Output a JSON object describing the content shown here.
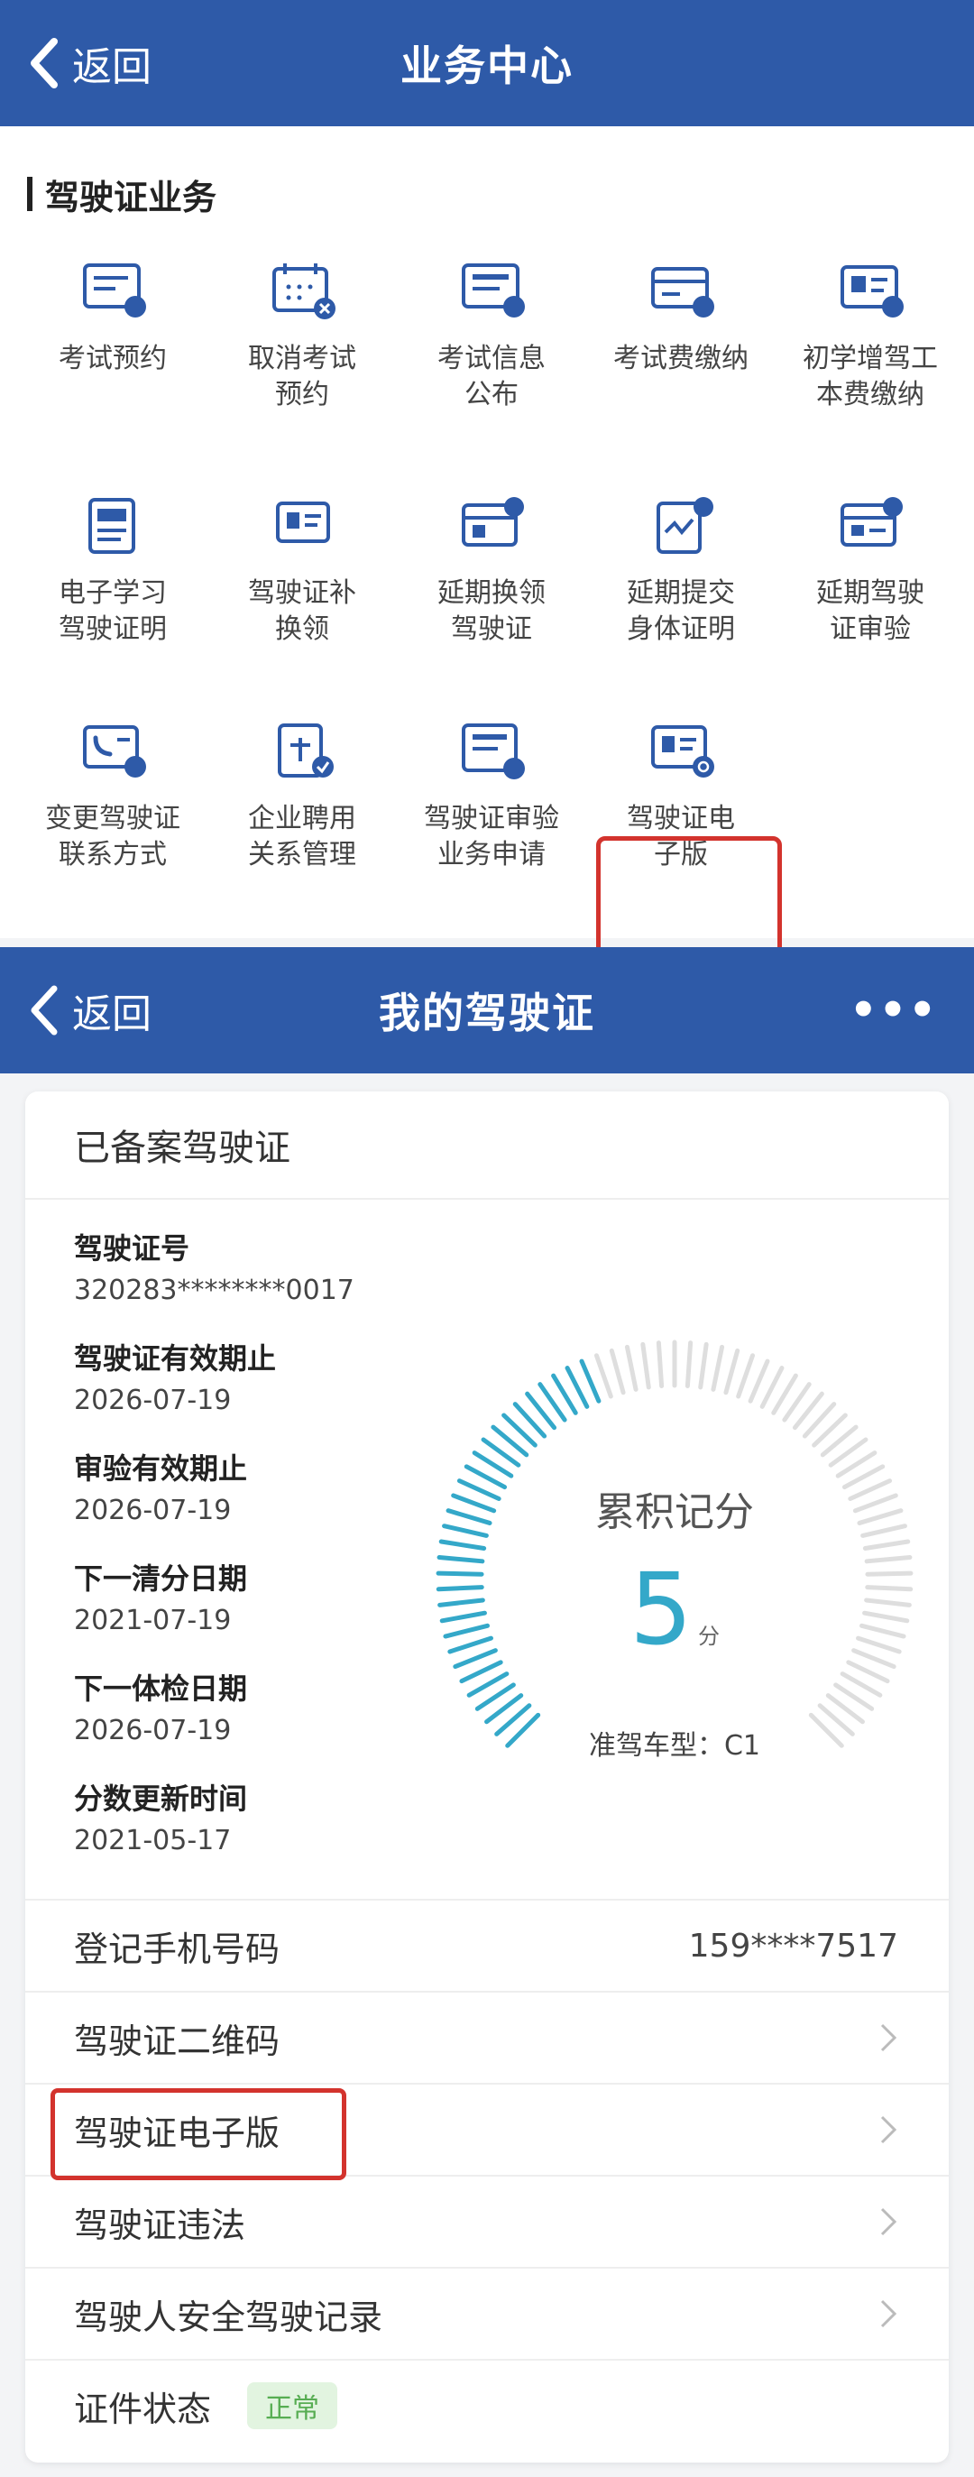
{
  "top_nav": {
    "back_label": "返回",
    "title": "业务中心"
  },
  "section": {
    "title": "驾驶证业务",
    "items": [
      {
        "label": "考试预约",
        "icon": "exam-booking-icon"
      },
      {
        "label": "取消考试\n预约",
        "icon": "calendar-cancel-icon"
      },
      {
        "label": "考试信息\n公布",
        "icon": "exam-info-icon"
      },
      {
        "label": "考试费缴纳",
        "icon": "exam-fee-icon"
      },
      {
        "label": "初学增驾工\n本费缴纳",
        "icon": "license-fee-icon"
      },
      {
        "label": "电子学习\n驾驶证明",
        "icon": "learning-cert-icon"
      },
      {
        "label": "驾驶证补\n换领",
        "icon": "license-reissue-icon"
      },
      {
        "label": "延期换领\n驾驶证",
        "icon": "license-delay-icon"
      },
      {
        "label": "延期提交\n身体证明",
        "icon": "health-cert-icon"
      },
      {
        "label": "延期驾驶\n证审验",
        "icon": "license-review-delay-icon"
      },
      {
        "label": "变更驾驶证\n联系方式",
        "icon": "contact-change-icon"
      },
      {
        "label": "企业聘用\n关系管理",
        "icon": "enterprise-doc-icon"
      },
      {
        "label": "驾驶证审验\n业务申请",
        "icon": "review-apply-icon"
      },
      {
        "label": "驾驶证电\n子版",
        "icon": "electronic-license-icon"
      }
    ]
  },
  "bottom_nav": {
    "back_label": "返回",
    "title": "我的驾驶证",
    "more": "•••"
  },
  "license": {
    "header": "已备案驾驶证",
    "fields": [
      {
        "label": "驾驶证号",
        "value": "320283********0017"
      },
      {
        "label": "驾驶证有效期止",
        "value": "2026-07-19"
      },
      {
        "label": "审验有效期止",
        "value": "2026-07-19"
      },
      {
        "label": "下一清分日期",
        "value": "2021-07-19"
      },
      {
        "label": "下一体检日期",
        "value": "2026-07-19"
      },
      {
        "label": "分数更新时间",
        "value": "2021-05-17"
      }
    ],
    "gauge": {
      "title": "累积记分",
      "score": "5",
      "unit": "分",
      "max_score": 12,
      "car_type": "准驾车型：C1"
    },
    "rows": [
      {
        "label": "登记手机号码",
        "value": "159****7517"
      },
      {
        "label": "驾驶证二维码"
      },
      {
        "label": "驾驶证电子版"
      },
      {
        "label": "驾驶证违法"
      },
      {
        "label": "驾驶人安全驾驶记录"
      }
    ],
    "status": {
      "label": "证件状态",
      "badge": "正常"
    }
  },
  "colors": {
    "brand": "#2e5aa8",
    "highlight": "#d3332d",
    "gauge": "#34a8c9",
    "badge_bg": "#e2f4e0",
    "badge_text": "#57ad52"
  }
}
